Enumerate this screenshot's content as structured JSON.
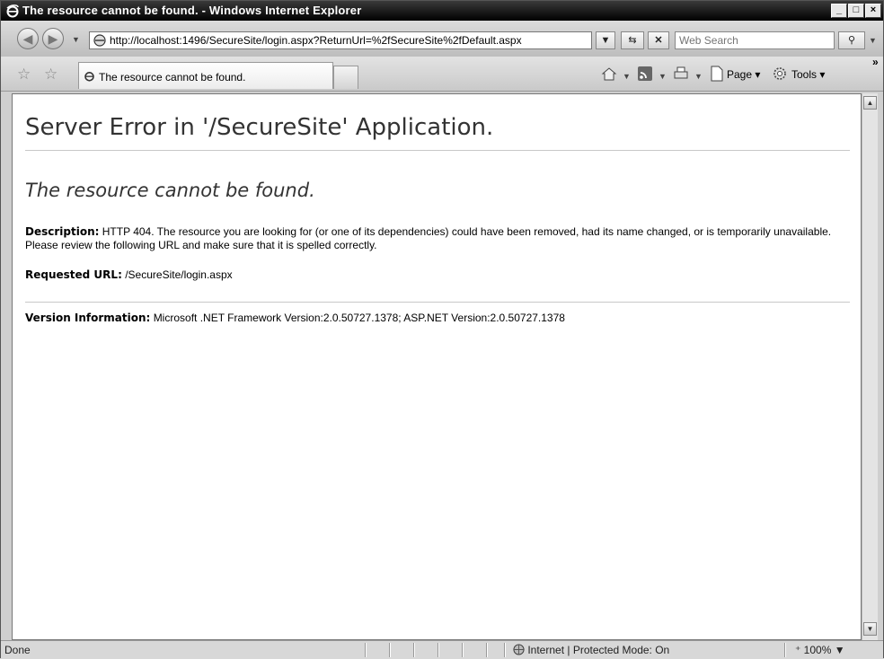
{
  "window": {
    "title": "The resource cannot be found. - Windows Internet Explorer",
    "minimize": "_",
    "maximize": "□",
    "close": "×"
  },
  "navigation": {
    "back_icon": "back-arrow-icon",
    "forward_icon": "forward-arrow-icon",
    "address_url": "http://localhost:1496/SecureSite/login.aspx?ReturnUrl=%2fSecureSite%2fDefault.aspx",
    "search_placeholder": "Web Search"
  },
  "command_bar": {
    "tab_label": "The resource cannot be found.",
    "page_label": "Page",
    "tools_label": "Tools",
    "chevron": "»"
  },
  "page": {
    "heading": "Server Error in '/SecureSite' Application.",
    "subheading": "The resource cannot be found.",
    "description_label": "Description:",
    "description_text": "HTTP 404. The resource you are looking for (or one of its dependencies) could have been removed, had its name changed, or is temporarily unavailable.  Please review the following URL and make sure that it is spelled correctly.",
    "requested_url_label": "Requested URL:",
    "requested_url_value": "/SecureSite/login.aspx",
    "version_label": "Version Information:",
    "version_value": "Microsoft .NET Framework Version:2.0.50727.1378; ASP.NET Version:2.0.50727.1378"
  },
  "status_bar": {
    "status_text": "Done",
    "zone_text": "Internet | Protected Mode: On",
    "zoom_text": "100%"
  }
}
